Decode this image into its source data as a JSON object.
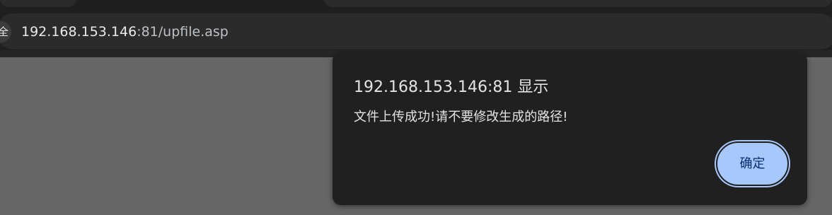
{
  "browser": {
    "site_chip_label": "全",
    "url_host": "192.168.153.146",
    "url_rest": ":81/upfile.asp"
  },
  "dialog": {
    "title": "192.168.153.146:81 显示",
    "message": "文件上传成功!请不要修改生成的路径!",
    "ok_label": "确定"
  },
  "colors": {
    "accent_button": "#a8c7fa",
    "dialog_background": "#202020",
    "page_overlay": "#666666"
  }
}
